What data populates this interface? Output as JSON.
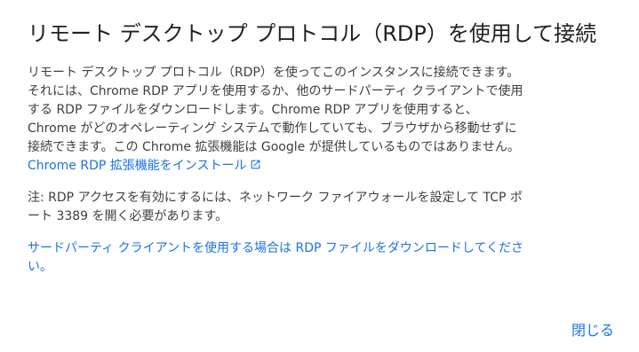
{
  "dialog": {
    "title": "リモート デスクトップ プロトコル（RDP）を使用して接続",
    "paragraph1_text": "リモート デスクトップ プロトコル（RDP）を使ってこのインスタンスに接続できます。それには、Chrome RDP アプリを使用するか、他のサードパーティ クライアントで使用する RDP ファイルをダウンロードします。Chrome RDP アプリを使用すると、Chrome がどのオペレーティング システムで動作していても、ブラウザから移動せずに接続できます。この Chrome 拡張機能は Google が提供しているものではありません。",
    "install_link": "Chrome RDP 拡張機能をインストール",
    "install_link_icon": "open-in-new-icon",
    "note_text": "注: RDP アクセスを有効にするには、ネットワーク ファイアウォールを設定して TCP ポート 3389 を開く必要があります。",
    "download_link": "サードパーティ クライアントを使用する場合は RDP ファイルをダウンロードしてください。",
    "close_label": "閉じる"
  },
  "colors": {
    "link": "#1a73e8",
    "title": "#202124",
    "body": "#3c4043",
    "background": "#ffffff"
  }
}
